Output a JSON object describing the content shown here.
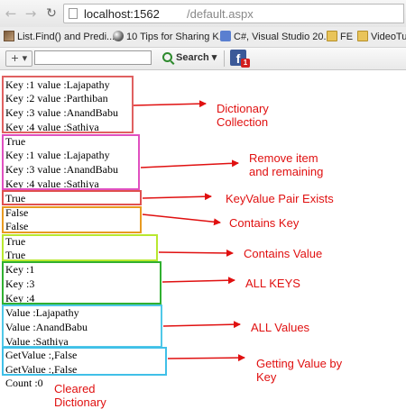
{
  "browser": {
    "url_host": "localhost:1562",
    "url_path": "/default.aspx",
    "bookmarks": [
      "List.Find() and Predi...",
      "10 Tips for Sharing K...",
      "C#, Visual Studio 20...",
      "FE",
      "VideoTuts"
    ],
    "toolbar": {
      "plus_label": "+ ▾",
      "search_label": "Search ▾",
      "facebook_glyph": "f",
      "facebook_badge": "1"
    }
  },
  "output": {
    "dictionary": [
      "Key :1 value :Lajapathy",
      "Key :2 value :Parthiban",
      "Key :3 value :AnandBabu",
      "Key :4 value :Sathiya"
    ],
    "after_remove": [
      "True",
      "Key :1 value :Lajapathy",
      "Key :3 value :AnandBabu",
      "Key :4 value :Sathiya"
    ],
    "keyvalue_exists": [
      "True"
    ],
    "contains_key": [
      "False",
      "False"
    ],
    "contains_value": [
      "True",
      "True"
    ],
    "all_keys": [
      "Key :1",
      "Key :3",
      "Key :4"
    ],
    "all_values": [
      "Value :Lajapathy",
      "Value :AnandBabu",
      "Value :Sathiya"
    ],
    "get_value": [
      "GetValue :,False",
      "GetValue :,False"
    ],
    "count": "Count :0"
  },
  "annotations": {
    "dictionary": [
      "Dictionary",
      "Collection"
    ],
    "remove": [
      "Remove item",
      "and remaining"
    ],
    "keyvalue": "KeyValue Pair Exists",
    "contains_key": "Contains Key",
    "contains_value": "Contains Value",
    "all_keys": "ALL KEYS",
    "all_values": "ALL Values",
    "get_value": [
      "Getting Value by",
      "Key"
    ],
    "cleared": [
      "Cleared",
      "Dictionary"
    ]
  },
  "colors": {
    "annotation": "#e01010",
    "box_dictionary": "#e06060",
    "box_remove": "#e050c0",
    "box_keyvalue": "#e05050",
    "box_contains_key": "#e89a20",
    "box_contains_value": "#b8e830",
    "box_keys": "#30b030",
    "box_values": "#50c8e8",
    "box_getvalue": "#40c0e8"
  },
  "icons": [
    "back-icon",
    "forward-icon",
    "reload-icon",
    "page-icon",
    "search-icon",
    "facebook-icon"
  ]
}
